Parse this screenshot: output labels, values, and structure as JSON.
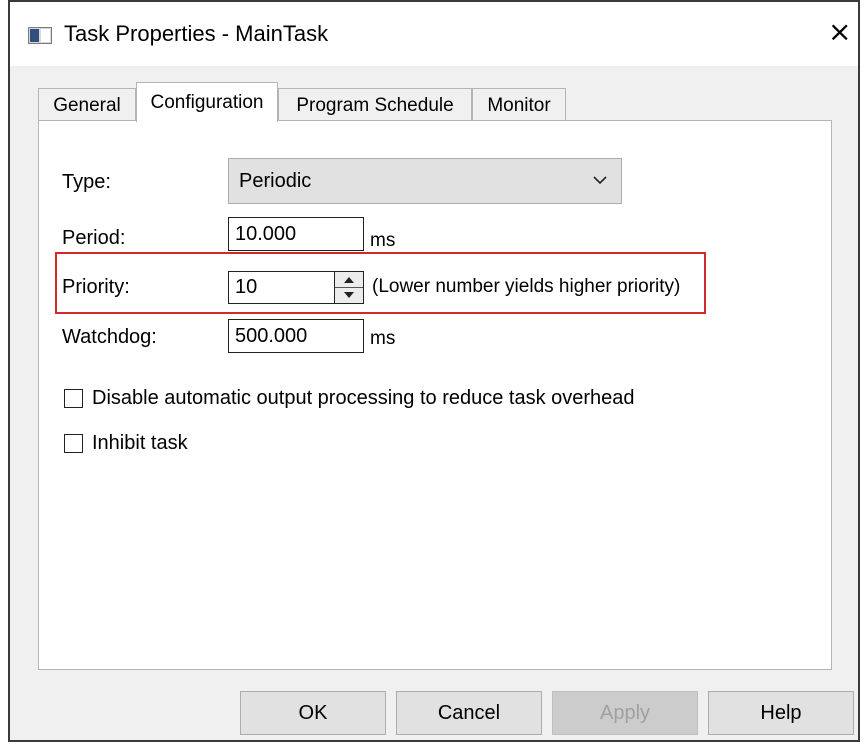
{
  "window": {
    "title": "Task Properties - MainTask",
    "close_glyph": "×",
    "icon": "window-app-icon"
  },
  "tabs": [
    {
      "label": "General",
      "active": false
    },
    {
      "label": "Configuration",
      "active": true
    },
    {
      "label": "Program Schedule",
      "active": false
    },
    {
      "label": "Monitor",
      "active": false
    }
  ],
  "form": {
    "type": {
      "label": "Type:",
      "value": "Periodic"
    },
    "period": {
      "label": "Period:",
      "value": "10.000",
      "unit": "ms"
    },
    "priority": {
      "label": "Priority:",
      "value": "10",
      "hint": "(Lower number yields higher priority)"
    },
    "watchdog": {
      "label": "Watchdog:",
      "value": "500.000",
      "unit": "ms"
    }
  },
  "checkboxes": [
    {
      "label": "Disable automatic output processing to reduce task overhead",
      "checked": false
    },
    {
      "label": "Inhibit task",
      "checked": false
    }
  ],
  "buttons": {
    "ok": "OK",
    "cancel": "Cancel",
    "apply": "Apply",
    "help": "Help"
  },
  "colors": {
    "highlight": "#d22a2a",
    "apply_disabled_text": "#a0a0a0"
  }
}
